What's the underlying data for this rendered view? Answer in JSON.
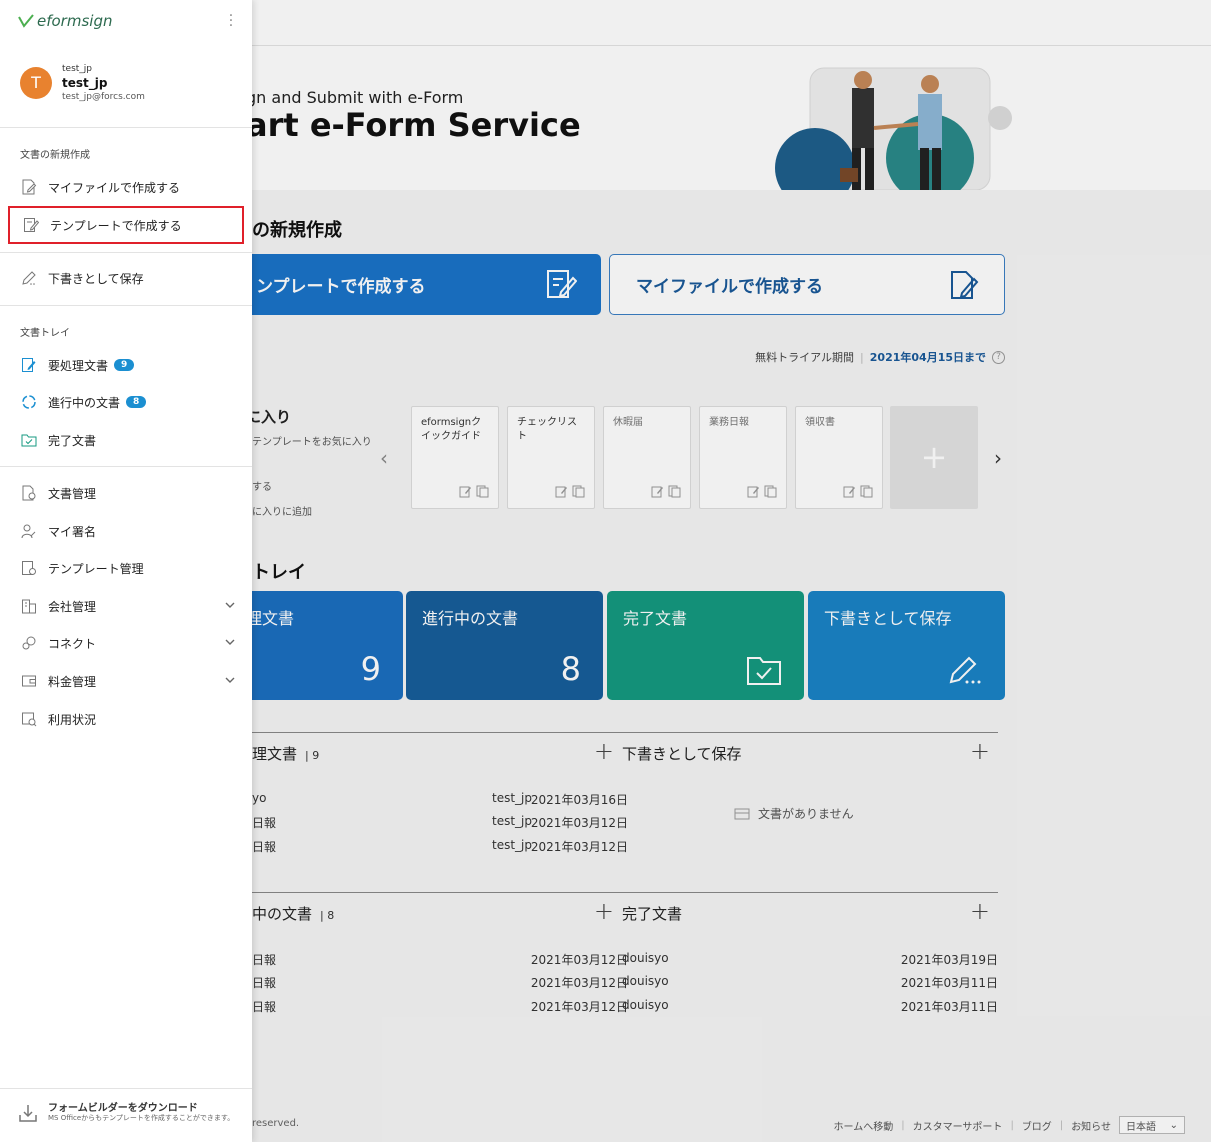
{
  "drawer": {
    "logo_text": "eformsign",
    "user": {
      "avatar_letter": "T",
      "id": "test_jp",
      "name": "test_jp",
      "email": "test_jp@forcs.com"
    },
    "group_new": "文書の新規作成",
    "create_myfile": "マイファイルで作成する",
    "create_template": "テンプレートで作成する",
    "save_draft": "下書きとして保存",
    "group_tray": "文書トレイ",
    "todo": "要処理文書",
    "todo_count": "9",
    "inprogress": "進行中の文書",
    "inprogress_count": "8",
    "completed": "完了文書",
    "doc_manage": "文書管理",
    "my_signature": "マイ署名",
    "template_manage": "テンプレート管理",
    "company_manage": "会社管理",
    "connect": "コネクト",
    "billing": "料金管理",
    "usage": "利用状況",
    "download_title": "フォームビルダーをダウンロード",
    "download_sub": "MS Officeからもテンプレートを作成することができます。"
  },
  "hero": {
    "subtitle": "gn and Submit with e-Form",
    "title": "art e-Form Service"
  },
  "new_doc": {
    "section_title": "の新規作成",
    "template_button": "ンプレートで作成する",
    "myfile_button": "マイファイルで作成する"
  },
  "trial": {
    "label": "無料トライアル期間",
    "date": "2021年04月15日まで",
    "help": "?"
  },
  "favorites": {
    "title": "に入り",
    "desc1": "テンプレートをお気に入り",
    "desc2": "する",
    "desc3": "に入りに追加",
    "prev": "‹",
    "next": "›",
    "add": "+",
    "cards": [
      "eformsignクイックガイド",
      "チェックリスト",
      "休暇届",
      "業務日報",
      "領収書"
    ]
  },
  "tray": {
    "section_title": "トレイ",
    "tiles": [
      {
        "label": "理文書",
        "count": "9",
        "color": "#1b6fc0"
      },
      {
        "label": "進行中の文書",
        "count": "8",
        "color": "#175e9b"
      },
      {
        "label": "完了文書",
        "color": "#159a80"
      },
      {
        "label": "下書きとして保存",
        "color": "#1a83c6"
      }
    ]
  },
  "panels": {
    "todo": {
      "title": "理文書",
      "count": "9",
      "plus": "+",
      "rows": [
        {
          "name": "yo",
          "user": "test_jp",
          "date": "2021年03月16日"
        },
        {
          "name": "日報",
          "user": "test_jp",
          "date": "2021年03月12日"
        },
        {
          "name": "日報",
          "user": "test_jp",
          "date": "2021年03月12日"
        }
      ]
    },
    "draft": {
      "title": "下書きとして保存",
      "plus": "+",
      "empty": "文書がありません"
    },
    "inprogress": {
      "title": "中の文書",
      "count": "8",
      "plus": "+",
      "rows": [
        {
          "name": "日報",
          "date": "2021年03月12日"
        },
        {
          "name": "日報",
          "date": "2021年03月12日"
        },
        {
          "name": "日報",
          "date": "2021年03月12日"
        }
      ]
    },
    "completed": {
      "title": "完了文書",
      "plus": "+",
      "rows": [
        {
          "name": "douisyo",
          "date": "2021年03月19日"
        },
        {
          "name": "douisyo",
          "date": "2021年03月11日"
        },
        {
          "name": "douisyo",
          "date": "2021年03月11日"
        }
      ]
    }
  },
  "footer": {
    "copyright": "reserved.",
    "home": "ホームへ移動",
    "support": "カスタマーサポート",
    "blog": "ブログ",
    "notice": "お知らせ",
    "language": "日本語"
  },
  "colors": {
    "primary": "#1a73c8",
    "highlight_border": "#e0202a",
    "badge": "#1b8fd1",
    "avatar": "#e8822f"
  }
}
